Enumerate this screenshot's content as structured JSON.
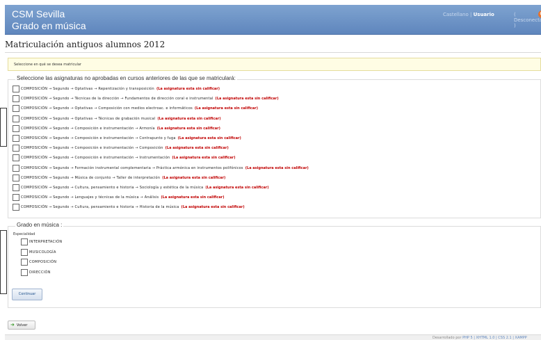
{
  "header": {
    "app_title": "CSM Sevilla",
    "app_subtitle": "Grado en música",
    "user_prefix": "Castellano |",
    "user_name": "Usuario",
    "logout_label": "( Desconectar )",
    "logout_icon": "power-icon"
  },
  "page": {
    "title": "Matriculación antiguos alumnos 2012",
    "notice": "Seleccione en qué se desea matricular"
  },
  "subjects_section": {
    "legend": "Seleccione las asignaturas no aprobadas en cursos anteriores de las que se matriculará:",
    "warning": "(La asignatura esta sin calificar)",
    "items": [
      {
        "text": "COMPOSICIÓN → Segundo → Optativas → Repentización y transposición"
      },
      {
        "text": "COMPOSICIÓN → Segundo → Técnicas de la dirección → Fundamentos de dirección coral e instrumental"
      },
      {
        "text": "COMPOSICIÓN → Segundo → Optativas → Composición con medios electroac. e informáticos"
      },
      {
        "text": "COMPOSICIÓN → Segundo → Optativas → Técnicas de grabación musical"
      },
      {
        "text": "COMPOSICIÓN → Segundo → Composición e instrumentación → Armonía"
      },
      {
        "text": "COMPOSICIÓN → Segundo → Composición e instrumentación → Contrapunto y fuga"
      },
      {
        "text": "COMPOSICIÓN → Segundo → Composición e instrumentación → Composición"
      },
      {
        "text": "COMPOSICIÓN → Segundo → Composición e instrumentación → Instrumentación"
      },
      {
        "text": "COMPOSICIÓN → Segundo → Formación instrumental complementaria → Práctica armónica en instrumentos polifónicos"
      },
      {
        "text": "COMPOSICIÓN → Segundo → Música de conjunto → Taller de interpretación"
      },
      {
        "text": "COMPOSICIÓN → Segundo → Cultura, pensamiento e historia → Sociología y estética de la música"
      },
      {
        "text": "COMPOSICIÓN → Segundo → Lenguajes y técnicas de la música → Análisis"
      },
      {
        "text": "COMPOSICIÓN → Segundo → Cultura, pensamiento e historia → Historia de la música"
      }
    ]
  },
  "degree_section": {
    "legend": "Grado en música :",
    "specialty_label": "Especialidad",
    "options": [
      {
        "label": "INTERPRETACIÓN"
      },
      {
        "label": "MUSICOLOGÍA"
      },
      {
        "label": "COMPOSICIÓN"
      },
      {
        "label": "DIRECCIÓN"
      }
    ]
  },
  "actions": {
    "submit_label": "Continuar",
    "back_label": "Volver",
    "back_icon": "back-arrow-icon"
  },
  "footer": {
    "credits_prefix": "Desarrollado por",
    "credits_links": "PHP 5 | XHTML 1.0 | CSS 2.1 | XAMPP"
  }
}
